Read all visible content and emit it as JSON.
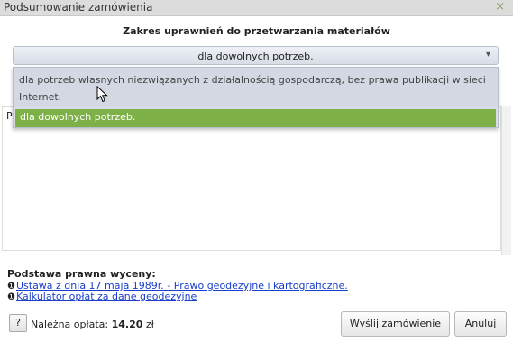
{
  "window": {
    "title": "Podsumowanie zamówienia",
    "close_icon": "×"
  },
  "scope": {
    "heading": "Zakres uprawnień do przetwarzania materiałów",
    "selected_value": "dla dowolnych potrzeb.",
    "arrow_icon": "▾",
    "options": [
      "dla potrzeb własnych niezwiązanych z działalnością gospodarczą, bez prawa publikacji w sieci Internet.",
      "dla dowolnych potrzeb."
    ],
    "highlight_color": "#7db147"
  },
  "content": {
    "partial_text": "P"
  },
  "legal": {
    "heading": "Podstawa prawna wyceny:",
    "info_icon": "❶",
    "links": [
      "Ustawa z dnia 17 maja 1989r. - Prawo geodezyjne i kartograficzne.",
      "Kalkulator opłat za dane geodezyjne"
    ]
  },
  "footer": {
    "help_label": "?",
    "fee_label": "Należna opłata:",
    "fee_amount": "14.20",
    "fee_currency": "zł",
    "send_label": "Wyślij zamówienie",
    "cancel_label": "Anuluj"
  }
}
